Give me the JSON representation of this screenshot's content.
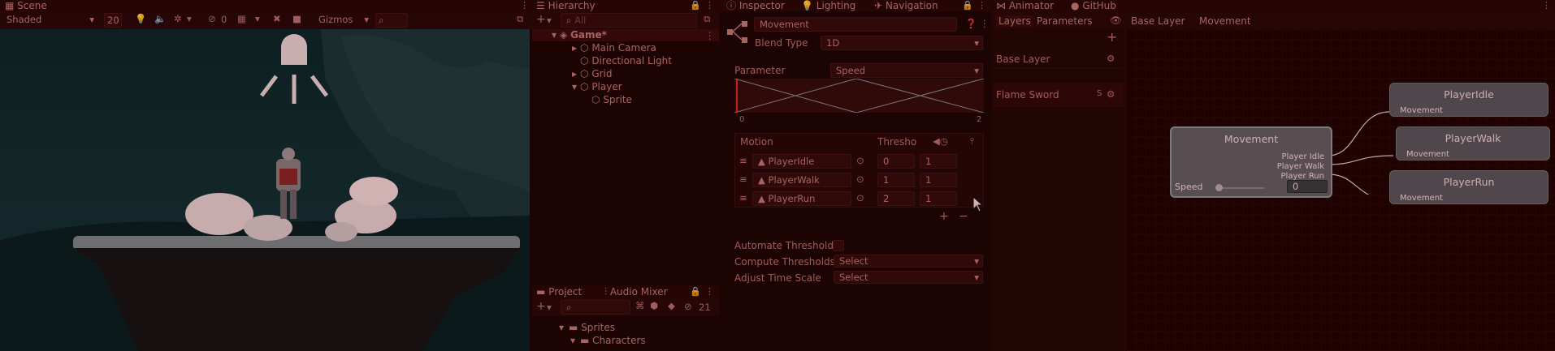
{
  "scene": {
    "tab": "Scene",
    "shading": "Shaded",
    "mode2d": "20",
    "hidden_count": "0",
    "gizmos": "Gizmos"
  },
  "hierarchy": {
    "tab": "Hierarchy",
    "search": "All",
    "items": [
      {
        "label": "Game*"
      },
      {
        "label": "Main Camera"
      },
      {
        "label": "Directional Light"
      },
      {
        "label": "Grid"
      },
      {
        "label": "Player"
      },
      {
        "label": "Sprite"
      }
    ]
  },
  "project": {
    "tab": "Project",
    "mixer_tab": "Audio Mixer",
    "count": "21",
    "items": [
      {
        "label": "Sprites"
      },
      {
        "label": "Characters"
      }
    ]
  },
  "inspector": {
    "tabs": [
      "Inspector",
      "Lighting",
      "Navigation"
    ],
    "title": "Movement",
    "blend_type_label": "Blend Type",
    "blend_type": "1D",
    "parameter_label": "Parameter",
    "parameter": "Speed",
    "axis_min": "0",
    "axis_max": "2",
    "motion_header": "Motion",
    "threshold_header": "Thresho",
    "motions": [
      {
        "name": "PlayerIdle",
        "threshold": "0",
        "speed": "1"
      },
      {
        "name": "PlayerWalk",
        "threshold": "1",
        "speed": "1"
      },
      {
        "name": "PlayerRun",
        "threshold": "2",
        "speed": "1"
      }
    ],
    "automate_label": "Automate Thresholds",
    "compute_label": "Compute Thresholds",
    "compute_value": "Select",
    "adjust_label": "Adjust Time Scale",
    "adjust_value": "Select"
  },
  "animator": {
    "tabs": [
      "Animator",
      "GitHub"
    ],
    "layers_tab": "Layers",
    "parameters_tab": "Parameters",
    "breadcrumb": [
      "Base Layer",
      "Movement"
    ],
    "layers": [
      {
        "name": "Base Layer"
      },
      {
        "name": "Flame Sword",
        "badge": "S"
      }
    ],
    "blend_node": {
      "title": "Movement",
      "outputs": [
        "Player Idle",
        "Player Walk",
        "Player Run"
      ],
      "param": "Speed",
      "value": "0"
    },
    "states": [
      {
        "title": "PlayerIdle",
        "input": "Movement"
      },
      {
        "title": "PlayerWalk",
        "input": "Movement"
      },
      {
        "title": "PlayerRun",
        "input": "Movement"
      }
    ]
  },
  "colors": {
    "accent": "#d93030",
    "panel": "#210505"
  }
}
